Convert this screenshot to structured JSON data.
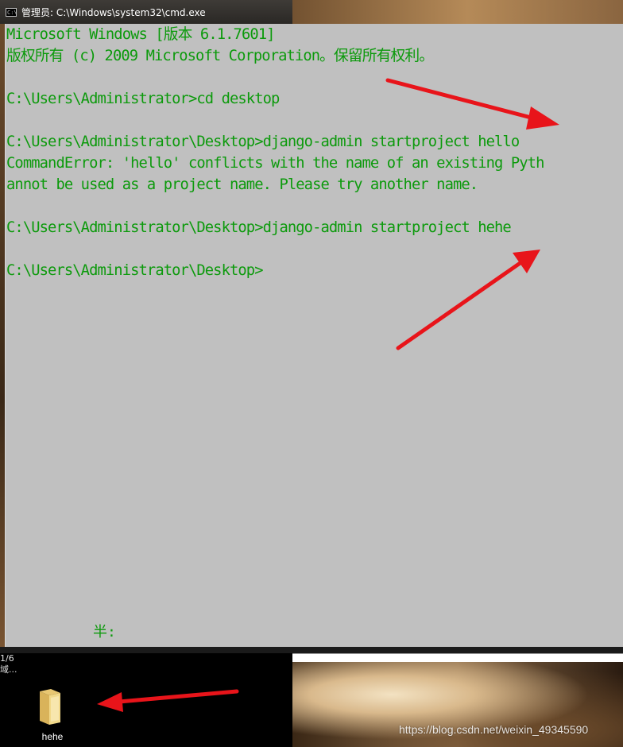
{
  "window": {
    "title": "管理员: C:\\Windows\\system32\\cmd.exe",
    "icon": "cmd-icon",
    "icon_text": "C:\\"
  },
  "console": {
    "text_color": "#0c9a0c",
    "background_color": "#c0c0c0",
    "lines": [
      "Microsoft Windows [版本 6.1.7601]",
      "版权所有 (c) 2009 Microsoft Corporation。保留所有权利。",
      "",
      "C:\\Users\\Administrator>cd desktop",
      "",
      "C:\\Users\\Administrator\\Desktop>django-admin startproject hello",
      "CommandError: 'hello' conflicts with the name of an existing Pyth",
      "annot be used as a project name. Please try another name.",
      "",
      "C:\\Users\\Administrator\\Desktop>django-admin startproject hehe",
      "",
      "C:\\Users\\Administrator\\Desktop>"
    ],
    "ime_status": "半:"
  },
  "explorer": {
    "status_count": "1/6",
    "status_field": "域...",
    "folder": {
      "label": "hehe",
      "icon": "folder-icon"
    }
  },
  "annotations": {
    "arrow_color": "#e8141a"
  },
  "watermark": "https://blog.csdn.net/weixin_49345590"
}
